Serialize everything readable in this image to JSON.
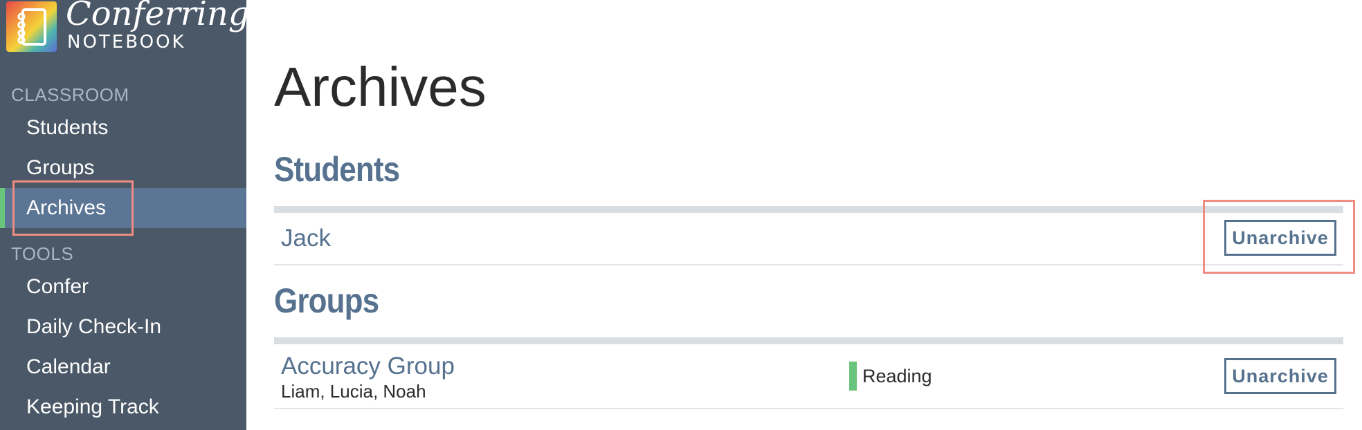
{
  "brand": {
    "line1": "Conferring",
    "line2": "NOTEBOOK"
  },
  "sidebar": {
    "sections": [
      {
        "label": "CLASSROOM",
        "items": [
          {
            "label": "Students",
            "active": false
          },
          {
            "label": "Groups",
            "active": false
          },
          {
            "label": "Archives",
            "active": true
          }
        ]
      },
      {
        "label": "TOOLS",
        "items": [
          {
            "label": "Confer",
            "active": false
          },
          {
            "label": "Daily Check-In",
            "active": false
          },
          {
            "label": "Calendar",
            "active": false
          },
          {
            "label": "Keeping Track",
            "active": false
          }
        ]
      }
    ]
  },
  "main": {
    "title": "Archives",
    "students": {
      "heading": "Students",
      "rows": [
        {
          "name": "Jack",
          "action": "Unarchive"
        }
      ]
    },
    "groups": {
      "heading": "Groups",
      "rows": [
        {
          "name": "Accuracy Group",
          "members": "Liam, Lucia, Noah",
          "subject": "Reading",
          "action": "Unarchive"
        }
      ]
    }
  },
  "colors": {
    "sidebar_bg": "#4b5867",
    "active_bg": "#5b7594",
    "accent_green": "#69c47c",
    "link_blue": "#56728f",
    "highlight": "#ef8d82"
  }
}
